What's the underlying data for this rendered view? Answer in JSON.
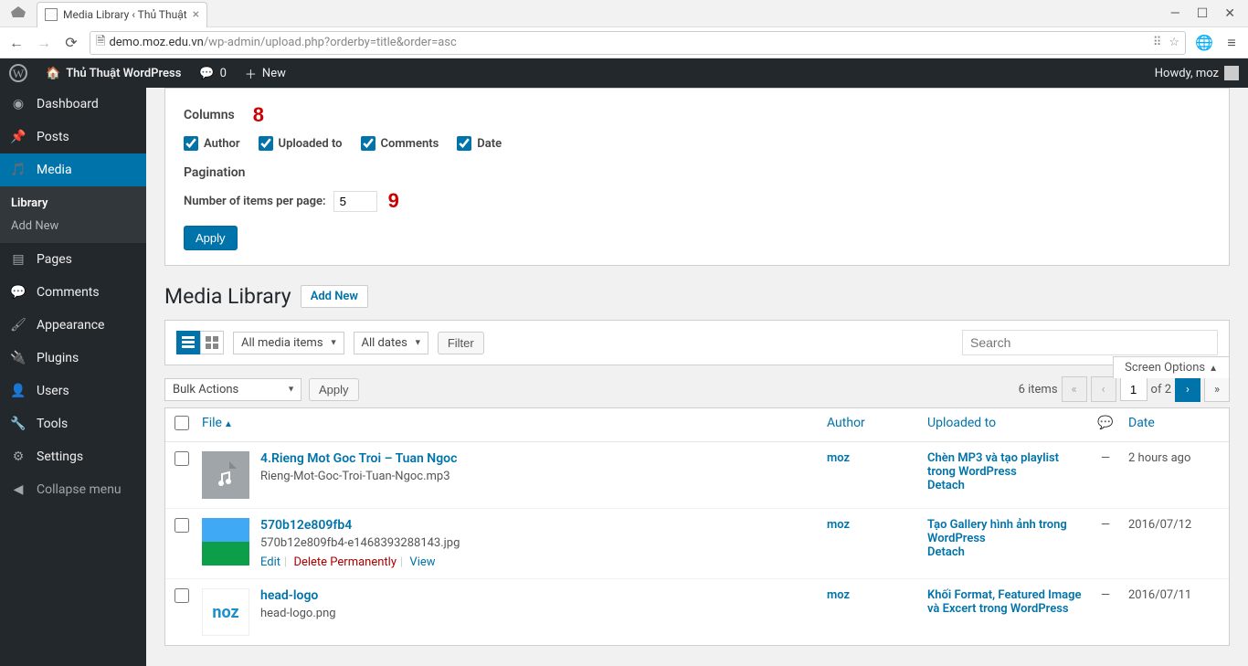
{
  "browser": {
    "tab_title": "Media Library ‹ Thủ Thuật",
    "url_host": "demo.moz.edu.vn",
    "url_path": "/wp-admin/upload.php?orderby=title&order=asc"
  },
  "adminbar": {
    "site_name": "Thủ Thuật WordPress",
    "comment_count": "0",
    "new_label": "New",
    "howdy": "Howdy, moz"
  },
  "menu": {
    "dashboard": "Dashboard",
    "posts": "Posts",
    "media": "Media",
    "library": "Library",
    "add_new": "Add New",
    "pages": "Pages",
    "comments": "Comments",
    "appearance": "Appearance",
    "plugins": "Plugins",
    "users": "Users",
    "tools": "Tools",
    "settings": "Settings",
    "collapse": "Collapse menu"
  },
  "screen_options": {
    "columns_label": "Columns",
    "annot8": "8",
    "cb_author": "Author",
    "cb_uploaded": "Uploaded to",
    "cb_comments": "Comments",
    "cb_date": "Date",
    "pagination_label": "Pagination",
    "items_label": "Number of items per page:",
    "items_value": "5",
    "annot9": "9",
    "apply": "Apply",
    "toggle": "Screen Options"
  },
  "heading": {
    "title": "Media Library",
    "add_new": "Add New"
  },
  "filters": {
    "media_items": "All media items",
    "dates": "All dates",
    "filter": "Filter",
    "search_placeholder": "Search"
  },
  "bulk": {
    "label": "Bulk Actions",
    "apply": "Apply"
  },
  "pagination": {
    "total": "6 items",
    "current": "1",
    "of": "of 2"
  },
  "table": {
    "headers": {
      "file": "File",
      "author": "Author",
      "uploaded": "Uploaded to",
      "date": "Date"
    },
    "rows": [
      {
        "title": "4.Rieng Mot Goc Troi – Tuan Ngoc",
        "filename": "Rieng-Mot-Goc-Troi-Tuan-Ngoc.mp3",
        "author": "moz",
        "uploaded": "Chèn MP3 và tạo playlist trong WordPress",
        "detach": "Detach",
        "comments": "—",
        "date": "2 hours ago",
        "thumb": "audio"
      },
      {
        "title": "570b12e809fb4",
        "filename": "570b12e809fb4-e1468393288143.jpg",
        "author": "moz",
        "uploaded": "Tạo Gallery hình ảnh trong WordPress",
        "detach": "Detach",
        "comments": "—",
        "date": "2016/07/12",
        "thumb": "image",
        "actions": {
          "edit": "Edit",
          "delete": "Delete Permanently",
          "view": "View"
        }
      },
      {
        "title": "head-logo",
        "filename": "head-logo.png",
        "author": "moz",
        "uploaded": "Khối Format, Featured Image và Excert trong WordPress",
        "comments": "—",
        "date": "2016/07/11",
        "thumb": "logo"
      }
    ]
  }
}
